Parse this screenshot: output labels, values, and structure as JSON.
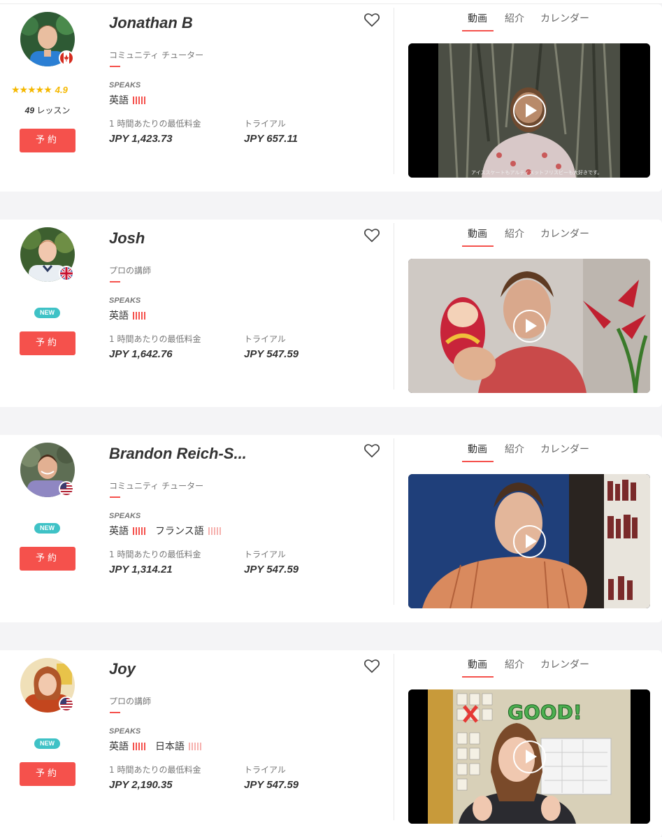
{
  "tabs": [
    "動画",
    "紹介",
    "カレンダー"
  ],
  "speaks_label": "SPEAKS",
  "price_label": "1 時間あたりの最低料金",
  "trial_label": "トライアル",
  "book_label": "予約",
  "new_label": "NEW",
  "colors": {
    "accent": "#f5514c",
    "new_badge": "#3fc2c6",
    "star": "#f5b800"
  },
  "tutors": [
    {
      "name": "Jonathan B",
      "flag": "canada-flag-icon",
      "rating": "4.9",
      "stars": "★★★★★",
      "lessons_count": "49",
      "lessons_unit": "レッスン",
      "role": "コミュニティ チューター",
      "languages": [
        {
          "name": "英語",
          "level": "native"
        }
      ],
      "price": "JPY 1,423.73",
      "trial": "JPY 657.11",
      "video_caption": "アイススケートもアルティメットフリスビーも大好きです。"
    },
    {
      "name": "Josh",
      "flag": "uk-flag-icon",
      "is_new": true,
      "role": "プロの講師",
      "languages": [
        {
          "name": "英語",
          "level": "native"
        }
      ],
      "price": "JPY 1,642.76",
      "trial": "JPY 547.59"
    },
    {
      "name": "Brandon Reich-S...",
      "flag": "us-flag-icon",
      "is_new": true,
      "role": "コミュニティ チューター",
      "languages": [
        {
          "name": "英語",
          "level": "native"
        },
        {
          "name": "フランス語",
          "level": "learning"
        }
      ],
      "price": "JPY 1,314.21",
      "trial": "JPY 547.59"
    },
    {
      "name": "Joy",
      "flag": "us-flag-icon",
      "is_new": true,
      "role": "プロの講師",
      "languages": [
        {
          "name": "英語",
          "level": "native"
        },
        {
          "name": "日本語",
          "level": "learning"
        }
      ],
      "price": "JPY 2,190.35",
      "trial": "JPY 547.59",
      "video_sign": "GOOD!"
    }
  ]
}
